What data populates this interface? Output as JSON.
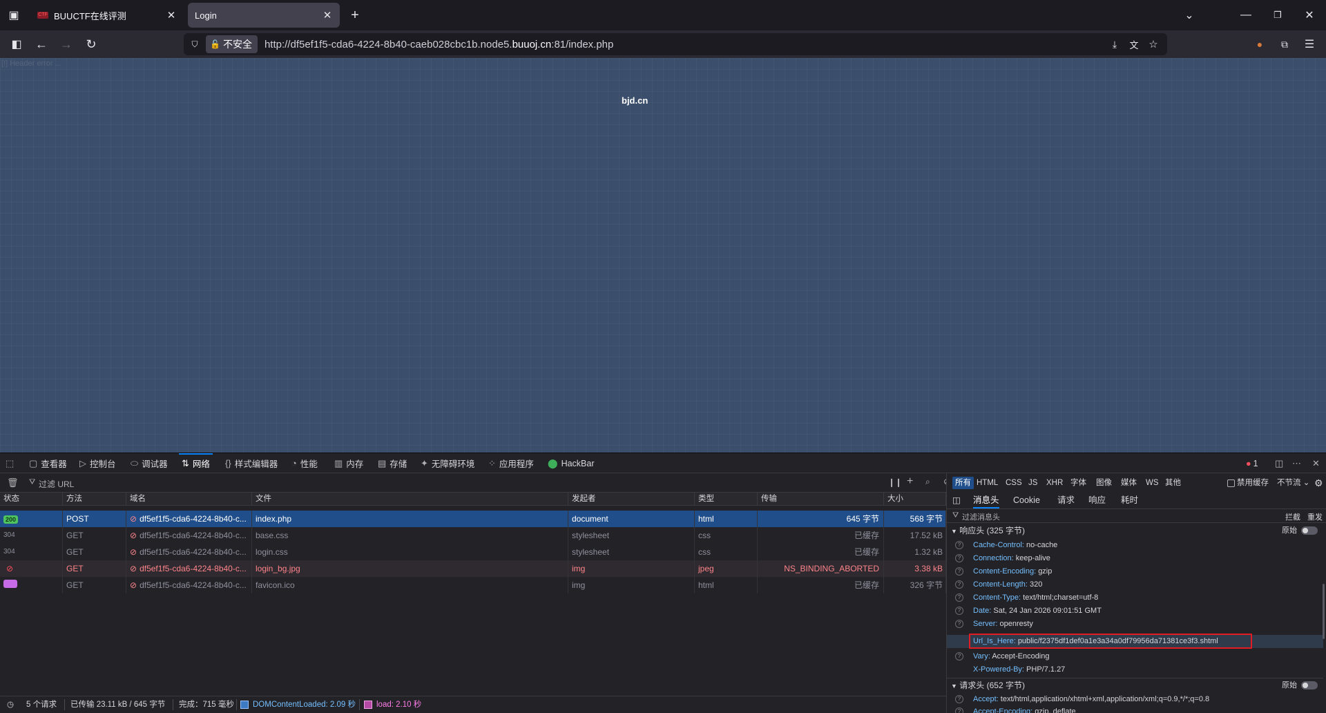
{
  "browser": {
    "tabs": [
      {
        "title": "BUUCTF在线评测",
        "favicon": "CTF",
        "active": false
      },
      {
        "title": "Login",
        "active": true
      }
    ],
    "new_tab_icon": "plus-icon",
    "address": {
      "security_label": "不安全",
      "url_prefix": "http://df5ef1f5-cda6-4224-8b40-caeb028cbc1b.node5.",
      "url_domain": "buuoj.cn",
      "url_suffix": ":81/index.php"
    }
  },
  "page": {
    "header_error": "[!] Header error ...",
    "site_name": "bjd.cn"
  },
  "devtools": {
    "tabs": [
      {
        "label": "查看器",
        "icon": "inspector-icon"
      },
      {
        "label": "控制台",
        "icon": "console-icon"
      },
      {
        "label": "调试器",
        "icon": "debugger-icon"
      },
      {
        "label": "网络",
        "icon": "network-icon",
        "active": true
      },
      {
        "label": "样式编辑器",
        "icon": "style-editor-icon"
      },
      {
        "label": "性能",
        "icon": "performance-icon"
      },
      {
        "label": "内存",
        "icon": "memory-icon"
      },
      {
        "label": "存储",
        "icon": "storage-icon"
      },
      {
        "label": "无障碍环境",
        "icon": "accessibility-icon"
      },
      {
        "label": "应用程序",
        "icon": "application-icon"
      },
      {
        "label": "HackBar",
        "icon": "hackbar-icon"
      }
    ],
    "error_count": "1",
    "filter_placeholder": "过滤 URL",
    "type_filters": [
      "所有",
      "HTML",
      "CSS",
      "JS",
      "XHR",
      "字体",
      "图像",
      "媒体",
      "WS",
      "其他"
    ],
    "disable_cache_label": "禁用缓存",
    "throttle_label": "不节流",
    "columns": [
      "状态",
      "方法",
      "域名",
      "文件",
      "发起者",
      "类型",
      "传输",
      "大小"
    ],
    "requests": [
      {
        "status": "200",
        "method": "POST",
        "domain": "df5ef1f5-cda6-4224-8b40-c...",
        "file": "index.php",
        "initiator": "document",
        "type": "html",
        "transferred": "645 字节",
        "size": "568 字节",
        "state": "selected"
      },
      {
        "status": "304",
        "method": "GET",
        "domain": "df5ef1f5-cda6-4224-8b40-c...",
        "file": "base.css",
        "initiator": "stylesheet",
        "type": "css",
        "transferred": "已缓存",
        "size": "17.52 kB",
        "state": "dim"
      },
      {
        "status": "304",
        "method": "GET",
        "domain": "df5ef1f5-cda6-4224-8b40-c...",
        "file": "login.css",
        "initiator": "stylesheet",
        "type": "css",
        "transferred": "已缓存",
        "size": "1.32 kB",
        "state": "dim"
      },
      {
        "status": "",
        "method": "GET",
        "domain": "df5ef1f5-cda6-4224-8b40-c...",
        "file": "login_bg.jpg",
        "initiator": "img",
        "type": "jpeg",
        "transferred": "NS_BINDING_ABORTED",
        "size": "3.38 kB",
        "state": "error"
      },
      {
        "status": "",
        "method": "GET",
        "domain": "df5ef1f5-cda6-4224-8b40-c...",
        "file": "favicon.ico",
        "initiator": "img",
        "type": "html",
        "transferred": "已缓存",
        "size": "326 字节",
        "state": "dim"
      }
    ],
    "statusbar": {
      "requests": "5 个请求",
      "transferred": "已传输 23.11 kB / 645 字节",
      "finish": "完成：715 毫秒",
      "dom_loaded": "DOMContentLoaded: 2.09 秒",
      "load": "load: 2.10 秒"
    },
    "details": {
      "tabs": [
        "消息头",
        "Cookie",
        "请求",
        "响应",
        "耗时"
      ],
      "block_label": "拦截",
      "resend_label": "重发",
      "filter_placeholder": "过滤消息头",
      "raw_label": "原始",
      "response_section": "响应头 (325 字节)",
      "response_headers": [
        {
          "name": "Cache-Control",
          "value": "no-cache"
        },
        {
          "name": "Connection",
          "value": "keep-alive"
        },
        {
          "name": "Content-Encoding",
          "value": "gzip"
        },
        {
          "name": "Content-Length",
          "value": "320"
        },
        {
          "name": "Content-Type",
          "value": "text/html;charset=utf-8"
        },
        {
          "name": "Date",
          "value": "Sat, 24 Jan 2026 09:01:51 GMT"
        },
        {
          "name": "Server",
          "value": "openresty"
        },
        {
          "name": "Url_Is_Here",
          "value": "public/f2375df1def0a1e3a34a0df79956da71381ce3f3.shtml"
        },
        {
          "name": "Vary",
          "value": "Accept-Encoding"
        },
        {
          "name": "X-Powered-By",
          "value": "PHP/7.1.27"
        }
      ],
      "request_section": "请求头 (652 字节)",
      "request_headers": [
        {
          "name": "Accept",
          "value": "text/html,application/xhtml+xml,application/xml;q=0.9,*/*;q=0.8"
        },
        {
          "name": "Accept-Encoding",
          "value": "gzip, deflate"
        }
      ]
    }
  },
  "colors": {
    "accent": "#0a84ff",
    "selected_row": "#204e8a",
    "highlight_box": "#e31b23",
    "header_key": "#75bfff"
  }
}
